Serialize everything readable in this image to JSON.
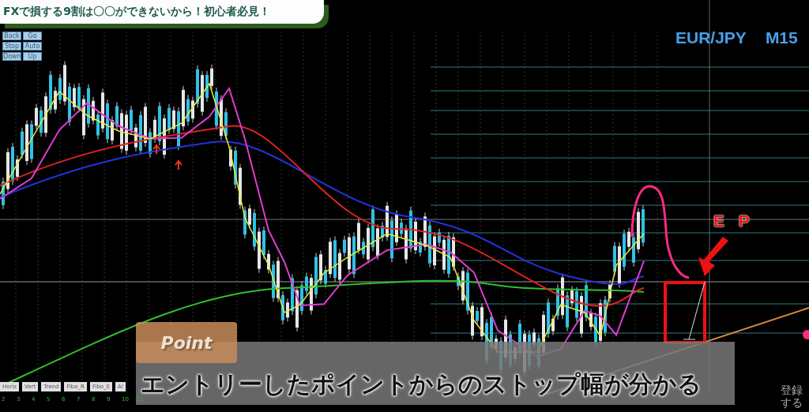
{
  "banner": {
    "title": "FXで損する9割は〇〇ができないから！初心者必見！"
  },
  "nav_buttons": [
    {
      "label": "Back"
    },
    {
      "label": "Go"
    },
    {
      "label": "Stop"
    },
    {
      "label": "Auto"
    },
    {
      "label": "Down"
    },
    {
      "label": "Up"
    }
  ],
  "chart_header": {
    "symbol": "EUR/JPY",
    "timeframe": "M15"
  },
  "entry_label": "E P",
  "point_badge": "Point",
  "caption": "エントリーしたポイントからのストップ幅が分かる",
  "toolbar_buttons": [
    {
      "label": "Horiz"
    },
    {
      "label": "Vert"
    },
    {
      "label": "Trend"
    },
    {
      "label": "Fibo_R"
    },
    {
      "label": "Fibo_E"
    },
    {
      "label": "Al"
    }
  ],
  "axis_labels": [
    "2",
    "3",
    "4",
    "5",
    "6",
    "7",
    "8",
    "9",
    "10",
    "11"
  ],
  "register_text": [
    "登録",
    "する"
  ]
}
